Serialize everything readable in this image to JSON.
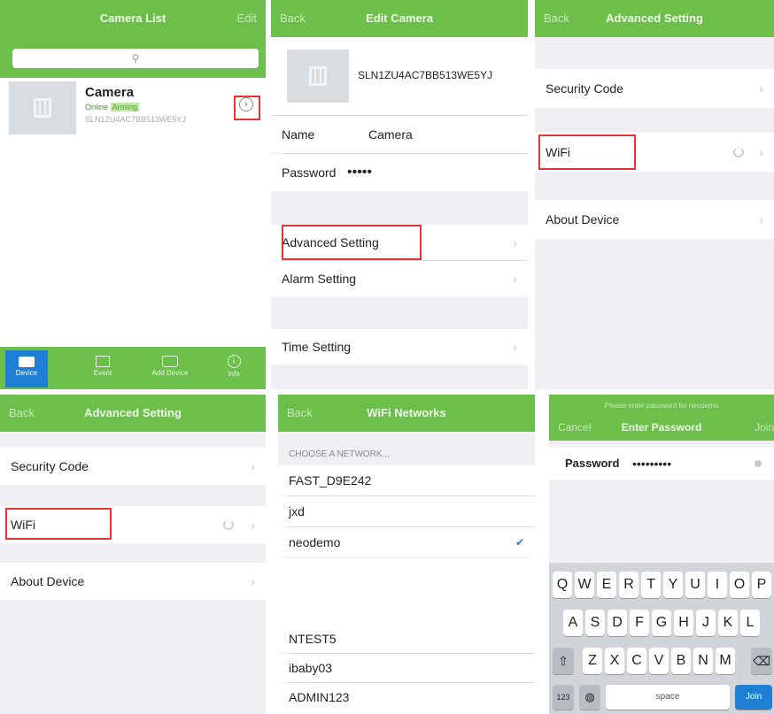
{
  "p1": {
    "nav_title": "Camera List",
    "nav_right": "Edit",
    "search_icon": "search-icon",
    "camera": {
      "name": "Camera",
      "status": "Online",
      "badge": "Arming",
      "id": "SLN1ZU4AC7BB513WE5YJ"
    },
    "tabs": [
      {
        "label": "Device",
        "icon": "video-icon"
      },
      {
        "label": "Event",
        "icon": "list-icon"
      },
      {
        "label": "Add Device",
        "icon": "add-device-icon"
      },
      {
        "label": "Info",
        "icon": "info-icon"
      }
    ]
  },
  "p2": {
    "nav_left": "Back",
    "nav_title": "Edit Camera",
    "camera_id": "SLN1ZU4AC7BB513WE5YJ",
    "name_label": "Name",
    "name_value": "Camera",
    "password_label": "Password",
    "password_value": "•••••",
    "items": [
      "Advanced Setting",
      "Alarm Setting",
      "Time Setting"
    ]
  },
  "p3": {
    "nav_left": "Back",
    "nav_title": "Advanced Setting",
    "items": [
      "Security Code",
      "WiFi",
      "About Device"
    ]
  },
  "p4": {
    "nav_left": "Back",
    "nav_title": "Advanced Setting",
    "items": [
      "Security Code",
      "WiFi",
      "About Device"
    ]
  },
  "p5": {
    "nav_left": "Back",
    "nav_title": "WiFi Networks",
    "section_header": "CHOOSE A NETWORK...",
    "networks_top": [
      "FAST_D9E242",
      "jxd",
      "neodemo"
    ],
    "networks_bottom": [
      "NTEST5",
      "ibaby03",
      "ADMIN123"
    ],
    "check": "✔"
  },
  "p6": {
    "prompt": "Please enter password for neodemo",
    "nav_left": "Cancel",
    "nav_title": "Enter Password",
    "nav_right": "Join",
    "password_label": "Password",
    "password_value": "•••••••••",
    "keys_row1": [
      "Q",
      "W",
      "E",
      "R",
      "T",
      "Y",
      "U",
      "I",
      "O",
      "P"
    ],
    "keys_row2": [
      "A",
      "S",
      "D",
      "F",
      "G",
      "H",
      "J",
      "K",
      "L"
    ],
    "keys_row3": [
      "Z",
      "X",
      "C",
      "V",
      "B",
      "N",
      "M"
    ],
    "key_123": "123",
    "key_space": "space",
    "key_join": "Join"
  },
  "colors": {
    "nav_green": "#6cbf4a",
    "highlight_red": "#e23636",
    "tab_active": "#1f7fd4",
    "check_blue": "#2a7ae2"
  }
}
